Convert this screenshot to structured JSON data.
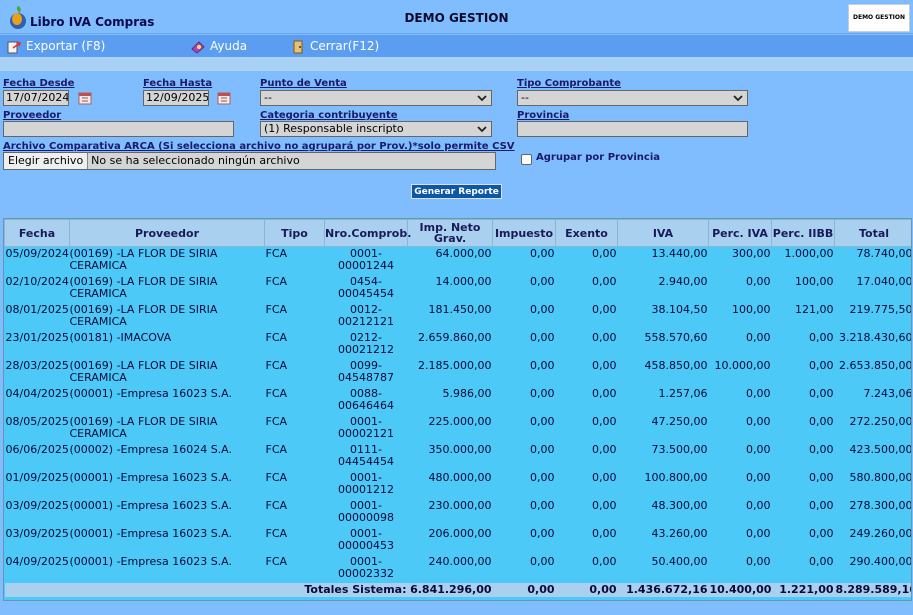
{
  "window": {
    "title": "Libro IVA Compras",
    "company": "DEMO GESTION",
    "logo_text": "DEMO GESTION"
  },
  "menu": [
    {
      "label": "Exportar (F8)",
      "icon": "export-icon"
    },
    {
      "label": "Ayuda",
      "icon": "help-icon"
    },
    {
      "label": "Cerrar(F12)",
      "icon": "close-icon"
    }
  ],
  "filters": {
    "fecha_desde_label": "Fecha Desde",
    "fecha_desde": "17/07/2024",
    "fecha_hasta_label": "Fecha Hasta",
    "fecha_hasta": "12/09/2025",
    "punto_venta_label": "Punto de Venta",
    "punto_venta": "--",
    "tipo_comprobante_label": "Tipo Comprobante",
    "tipo_comprobante": "--",
    "proveedor_label": "Proveedor",
    "proveedor": "",
    "categoria_label": "Categoria contribuyente",
    "categoria": "(1) Responsable inscripto",
    "provincia_label": "Provincia",
    "provincia": "",
    "archivo_label": "Archivo Comparativa ARCA (Si selecciona archivo no agrupará por Prov.)*solo permite CSV",
    "archivo_button": "Elegir archivo",
    "archivo_text": "No se ha seleccionado ningún archivo",
    "agrupar_label": "Agrupar por Provincia",
    "generar_label": "Generar Reporte"
  },
  "table": {
    "columns": [
      "Fecha",
      "Proveedor",
      "Tipo",
      "Nro.Comprob.",
      "Imp. Neto Grav.",
      "Impuesto",
      "Exento",
      "IVA",
      "Perc. IVA",
      "Perc. IIBB",
      "Total"
    ],
    "rows": [
      [
        "05/09/2024",
        "(00169) -LA FLOR DE SIRIA CERAMICA",
        "FCA",
        "0001-00001244",
        "64.000,00",
        "0,00",
        "0,00",
        "13.440,00",
        "300,00",
        "1.000,00",
        "78.740,00"
      ],
      [
        "02/10/2024",
        "(00169) -LA FLOR DE SIRIA CERAMICA",
        "FCA",
        "0454-00045454",
        "14.000,00",
        "0,00",
        "0,00",
        "2.940,00",
        "0,00",
        "100,00",
        "17.040,00"
      ],
      [
        "08/01/2025",
        "(00169) -LA FLOR DE SIRIA CERAMICA",
        "FCA",
        "0012-00212121",
        "181.450,00",
        "0,00",
        "0,00",
        "38.104,50",
        "100,00",
        "121,00",
        "219.775,50"
      ],
      [
        "23/01/2025",
        "(00181) -IMACOVA",
        "FCA",
        "0212-00021212",
        "2.659.860,00",
        "0,00",
        "0,00",
        "558.570,60",
        "0,00",
        "0,00",
        "3.218.430,60"
      ],
      [
        "28/03/2025",
        "(00169) -LA FLOR DE SIRIA CERAMICA",
        "FCA",
        "0099-04548787",
        "2.185.000,00",
        "0,00",
        "0,00",
        "458.850,00",
        "10.000,00",
        "0,00",
        "2.653.850,00"
      ],
      [
        "04/04/2025",
        "(00001) -Empresa 16023 S.A.",
        "FCA",
        "0088-00646464",
        "5.986,00",
        "0,00",
        "0,00",
        "1.257,06",
        "0,00",
        "0,00",
        "7.243,06"
      ],
      [
        "08/05/2025",
        "(00169) -LA FLOR DE SIRIA CERAMICA",
        "FCA",
        "0001-00002121",
        "225.000,00",
        "0,00",
        "0,00",
        "47.250,00",
        "0,00",
        "0,00",
        "272.250,00"
      ],
      [
        "06/06/2025",
        "(00002) -Empresa 16024 S.A.",
        "FCA",
        "0111-04454454",
        "350.000,00",
        "0,00",
        "0,00",
        "73.500,00",
        "0,00",
        "0,00",
        "423.500,00"
      ],
      [
        "01/09/2025",
        "(00001) -Empresa 16023 S.A.",
        "FCA",
        "0001-00001212",
        "480.000,00",
        "0,00",
        "0,00",
        "100.800,00",
        "0,00",
        "0,00",
        "580.800,00"
      ],
      [
        "03/09/2025",
        "(00001) -Empresa 16023 S.A.",
        "FCA",
        "0001-00000098",
        "230.000,00",
        "0,00",
        "0,00",
        "48.300,00",
        "0,00",
        "0,00",
        "278.300,00"
      ],
      [
        "03/09/2025",
        "(00001) -Empresa 16023 S.A.",
        "FCA",
        "0001-00000453",
        "206.000,00",
        "0,00",
        "0,00",
        "43.260,00",
        "0,00",
        "0,00",
        "249.260,00"
      ],
      [
        "04/09/2025",
        "(00001) -Empresa 16023 S.A.",
        "FCA",
        "0001-00002332",
        "240.000,00",
        "0,00",
        "0,00",
        "50.400,00",
        "0,00",
        "0,00",
        "290.400,00"
      ]
    ],
    "totals_label": "Totales Sistema:",
    "totals": [
      "6.841.296,00",
      "0,00",
      "0,00",
      "1.436.672,16",
      "10.400,00",
      "1.221,00",
      "8.289.589,16"
    ]
  }
}
